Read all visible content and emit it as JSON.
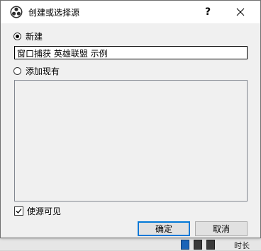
{
  "dialog": {
    "title": "创建或选择源",
    "help_label": "?",
    "app_icon": "obs-icon",
    "close_icon": "close-icon"
  },
  "options": {
    "create_new_label": "新建",
    "create_new_selected": true,
    "name_value": "窗口捕获 英雄联盟 示例",
    "add_existing_label": "添加现有",
    "add_existing_selected": false,
    "existing_sources": []
  },
  "visibility": {
    "label": "使源可见",
    "checked": true
  },
  "buttons": {
    "ok_label": "确定",
    "cancel_label": "取消"
  },
  "background": {
    "status_text": "时长"
  },
  "colors": {
    "accent": "#0078d7",
    "dialog_bg": "#f0f0f0",
    "titlebar_bg": "#ffffff"
  }
}
